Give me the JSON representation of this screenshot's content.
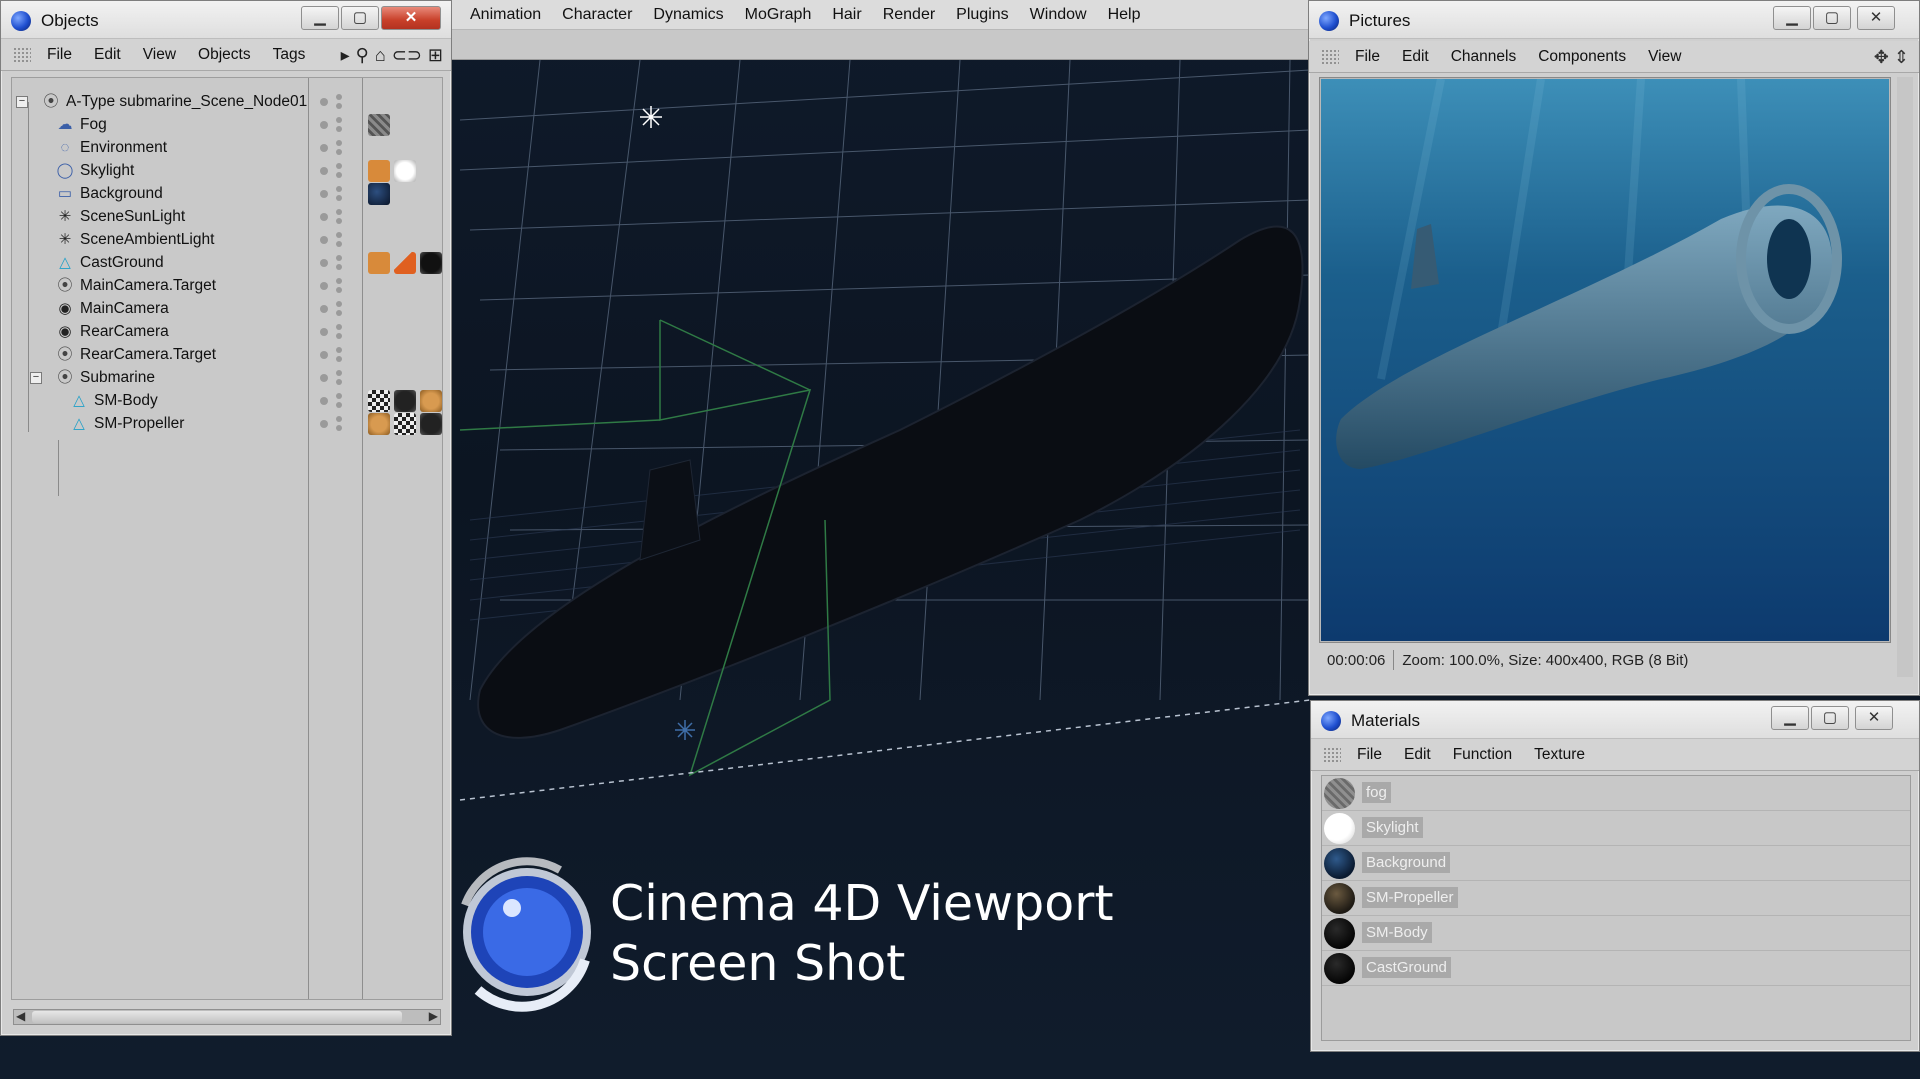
{
  "menubar": {
    "items": [
      "Animation",
      "Character",
      "Dynamics",
      "MoGraph",
      "Hair",
      "Render",
      "Plugins",
      "Window",
      "Help"
    ]
  },
  "objects_window": {
    "title": "Objects",
    "menu": [
      "File",
      "Edit",
      "View",
      "Objects",
      "Tags"
    ],
    "tree": [
      {
        "name": "A-Type submarine_Scene_Node01",
        "icon": "null-object-icon",
        "depth": 0,
        "expander": "−"
      },
      {
        "name": "Fog",
        "icon": "fog-icon",
        "depth": 1
      },
      {
        "name": "Environment",
        "icon": "environment-icon",
        "depth": 1
      },
      {
        "name": "Skylight",
        "icon": "sky-icon",
        "depth": 1
      },
      {
        "name": "Background",
        "icon": "background-icon",
        "depth": 1
      },
      {
        "name": "SceneSunLight",
        "icon": "light-icon",
        "depth": 1
      },
      {
        "name": "SceneAmbientLight",
        "icon": "light-icon",
        "depth": 1
      },
      {
        "name": "CastGround",
        "icon": "polygon-object-icon",
        "depth": 1
      },
      {
        "name": "MainCamera.Target",
        "icon": "null-object-icon",
        "depth": 1
      },
      {
        "name": "MainCamera",
        "icon": "camera-icon",
        "depth": 1
      },
      {
        "name": "RearCamera",
        "icon": "camera-icon",
        "depth": 1
      },
      {
        "name": "RearCamera.Target",
        "icon": "null-object-icon",
        "depth": 1
      },
      {
        "name": "Submarine",
        "icon": "null-object-icon",
        "depth": 1,
        "expander": "−"
      },
      {
        "name": "SM-Body",
        "icon": "polygon-object-icon",
        "depth": 2
      },
      {
        "name": "SM-Propeller",
        "icon": "polygon-object-icon",
        "depth": 2
      }
    ]
  },
  "pictures_window": {
    "title": "Pictures",
    "menu": [
      "File",
      "Edit",
      "Channels",
      "Components",
      "View"
    ],
    "status_time": "00:00:06",
    "status_info": "Zoom: 100.0%, Size: 400x400, RGB (8 Bit)"
  },
  "materials_window": {
    "title": "Materials",
    "menu": [
      "File",
      "Edit",
      "Function",
      "Texture"
    ],
    "materials": [
      {
        "name": "fog",
        "swatch": "fog-swatch"
      },
      {
        "name": "Skylight",
        "swatch": "white-swatch"
      },
      {
        "name": "Background",
        "swatch": "dark-blue-swatch"
      },
      {
        "name": "SM-Propeller",
        "swatch": "bronze-swatch"
      },
      {
        "name": "SM-Body",
        "swatch": "black-swatch"
      },
      {
        "name": "CastGround",
        "swatch": "black-swatch"
      }
    ]
  },
  "overlay": {
    "line1": "Cinema 4D Viewport",
    "line2": "Screen Shot"
  },
  "colors": {
    "viewport_bg": "#0f1a2a",
    "close_button": "#c8402a",
    "window_chrome": "#d3d3d3",
    "render_water": "#1b5f8c"
  }
}
